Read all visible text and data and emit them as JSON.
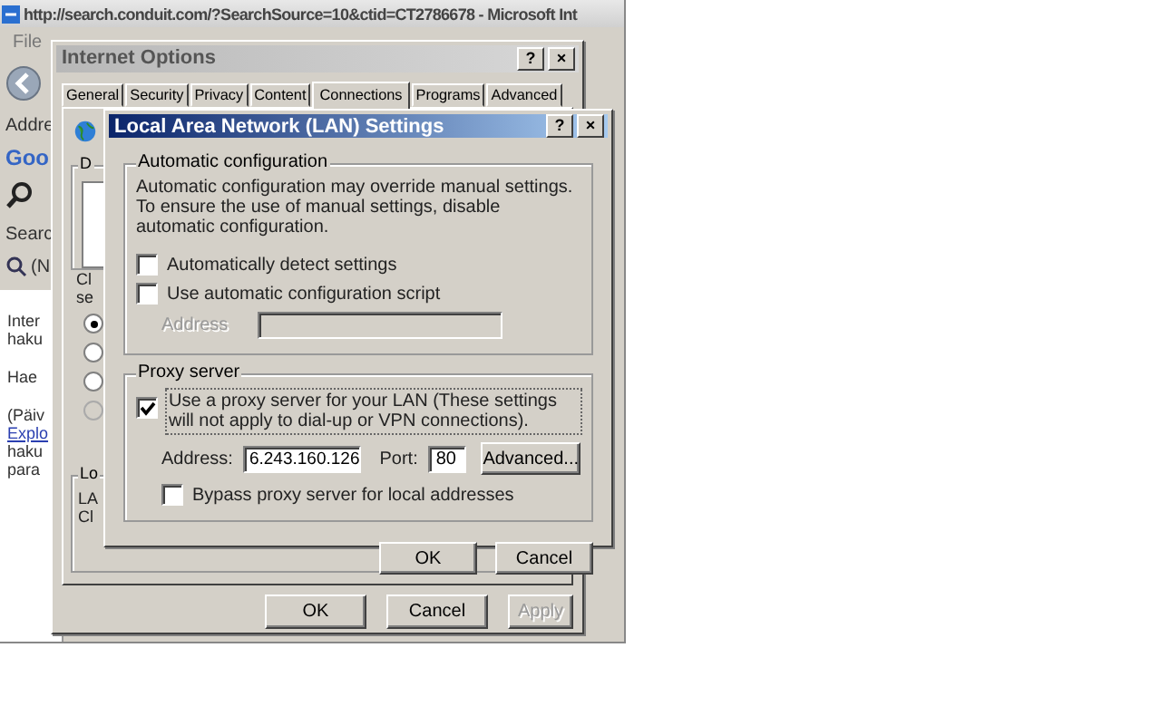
{
  "browser": {
    "title": "http://search.conduit.com/?SearchSource=10&ctid=CT2786678 - Microsoft Int",
    "menu": [
      "File"
    ],
    "address_label": "Addre",
    "toolbar_logo": "Goo",
    "tab_label": "Searc",
    "link_label": "(N",
    "content_lines": [
      {
        "text": "Inter",
        "kind": "text"
      },
      {
        "text": "haku",
        "kind": "text"
      },
      {
        "text": "Hae",
        "kind": "gap"
      },
      {
        "text": "(Päiv",
        "kind": "gap"
      },
      {
        "text": "Explo",
        "kind": "link"
      },
      {
        "text": "haku",
        "kind": "text"
      },
      {
        "text": "para",
        "kind": "text"
      }
    ]
  },
  "internet_options": {
    "title": "Internet Options",
    "title_buttons": [
      "?",
      "×"
    ],
    "tabs": [
      {
        "label": "General",
        "selected": false
      },
      {
        "label": "Security",
        "selected": false
      },
      {
        "label": "Privacy",
        "selected": false
      },
      {
        "label": "Content",
        "selected": false
      },
      {
        "label": "Connections",
        "selected": true
      },
      {
        "label": "Programs",
        "selected": false
      },
      {
        "label": "Advanced",
        "selected": false
      }
    ],
    "group_1_label": "D",
    "text_1": "Cl",
    "text_2": "se",
    "radios": [
      {
        "selected": true,
        "disabled": false
      },
      {
        "selected": false,
        "disabled": false
      },
      {
        "selected": false,
        "disabled": false
      },
      {
        "selected": false,
        "disabled": true
      }
    ],
    "group_2_label": "Lo",
    "text_3": "LA",
    "text_4": "Cl",
    "buttons": [
      {
        "label": "OK",
        "disabled": false
      },
      {
        "label": "Cancel",
        "disabled": false
      },
      {
        "label": "Apply",
        "disabled": true
      }
    ]
  },
  "lan_dialog": {
    "title": "Local Area Network (LAN) Settings",
    "title_buttons": [
      "?",
      "×"
    ],
    "auto_group": {
      "label": "Automatic configuration",
      "description": "Automatic configuration may override manual settings.  To ensure the use of manual settings, disable automatic configuration.",
      "options": [
        {
          "label": "Automatically detect settings",
          "checked": false
        },
        {
          "label": "Use automatic configuration script",
          "checked": false
        }
      ],
      "address": {
        "label": "Address",
        "disabled": true
      }
    },
    "proxy_group": {
      "label": "Proxy server",
      "use_proxy": {
        "label": "Use a proxy server for your LAN (These settings will not apply to dial-up or VPN connections).",
        "checked": true
      },
      "address": {
        "label": "Address:",
        "value": "6.243.160.126"
      },
      "port": {
        "label": "Port:",
        "value": "80"
      },
      "advanced_button": "Advanced...",
      "bypass": {
        "label": "Bypass proxy server for local addresses",
        "checked": false
      }
    },
    "buttons": [
      {
        "label": "OK"
      },
      {
        "label": "Cancel"
      }
    ]
  }
}
